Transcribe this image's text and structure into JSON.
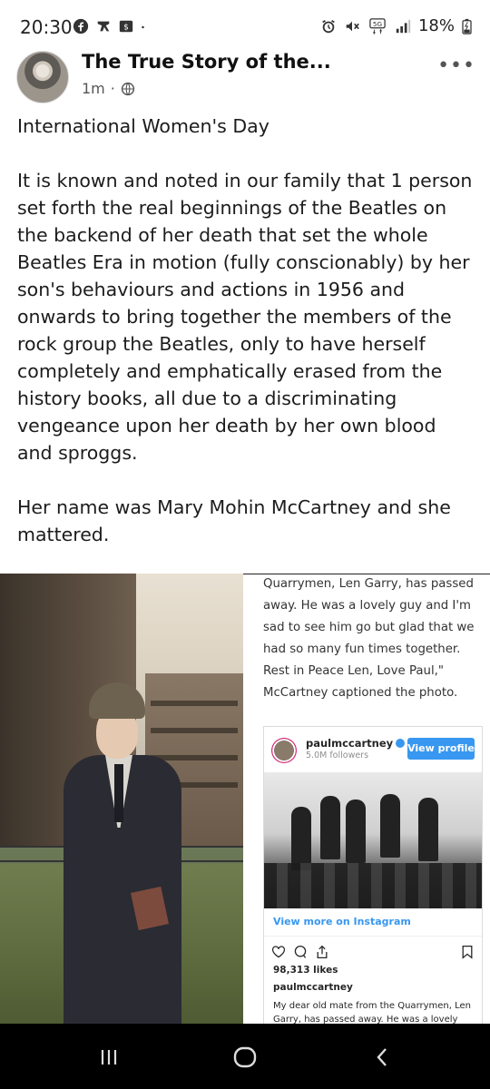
{
  "status_bar": {
    "time": "20:30",
    "left_icons": [
      "facebook-icon",
      "kitchen-icon",
      "dollar-icon",
      "dot-icon"
    ],
    "network": "5G",
    "battery": "18%",
    "right_icons": [
      "alarm-icon",
      "mute-icon",
      "5g-icon",
      "signal-icon",
      "battery-icon"
    ]
  },
  "post": {
    "author": "The True Story of the...",
    "time_ago": "1m",
    "separator": "·",
    "visibility_icon": "globe-icon",
    "more_label": "•••",
    "text_title": "International Women's Day",
    "text_body": "It is known and noted in our family that 1 person set forth the real beginnings of the Beatles on the backend of her death that set the whole Beatles Era in motion (fully conscionably) by her son's behaviours and actions  in 1956 and onwards to bring together the members of the rock group the Beatles, only to have herself completely and emphatically erased  from the history books, all due to a discriminating vengeance upon her death by her own blood and sproggs.",
    "text_end": "Her name was Mary Mohin McCartney and she mattered."
  },
  "article": {
    "caption": "Quarrymen, Len Garry, has passed away. He was a lovely guy and I'm sad to see him go but glad that we had so many fun times together. Rest in Peace Len, Love Paul,\" McCartney captioned the photo.",
    "instagram": {
      "username": "paulmccartney",
      "followers": "5.0M followers",
      "view_profile": "View profile",
      "view_more": "View more on Instagram",
      "likes": "98,313 likes",
      "owner": "paulmccartney",
      "caption": "My dear old mate from the Quarrymen, Len Garry, has passed away. He was a lovely guy and"
    }
  },
  "nav": {
    "recents": "recents-icon",
    "home": "home-icon",
    "back": "back-icon"
  },
  "colors": {
    "instagram_blue": "#3897f0",
    "nav_background": "#000000"
  }
}
